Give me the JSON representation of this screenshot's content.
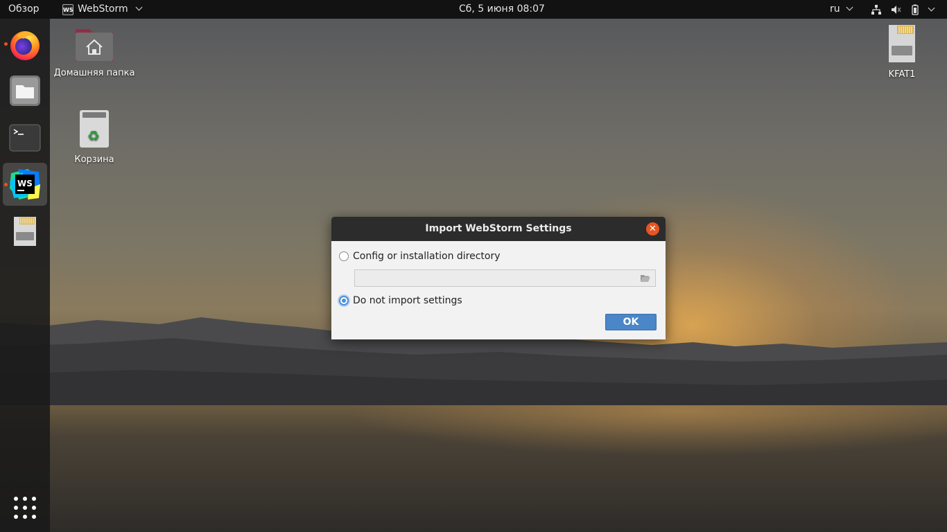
{
  "topbar": {
    "activities": "Обзор",
    "app_name": "WebStorm",
    "app_icon_text": "WS",
    "clock": "Сб, 5 июня  08:07",
    "language": "ru",
    "tray": [
      "network-icon",
      "volume-muted-icon",
      "battery-icon",
      "chevron-down-icon"
    ]
  },
  "dock": {
    "items": [
      {
        "name": "firefox",
        "icon": "firefox-icon",
        "running": true
      },
      {
        "name": "files",
        "icon": "files-icon",
        "running": false
      },
      {
        "name": "terminal",
        "icon": "terminal-icon",
        "running": false
      },
      {
        "name": "webstorm",
        "icon": "webstorm-icon",
        "running": true,
        "active": true,
        "icon_text": "WS"
      },
      {
        "name": "sd-card",
        "icon": "sd-card-icon",
        "running": false
      }
    ],
    "show_apps_icon": "apps-grid-icon"
  },
  "desktop": {
    "home_label": "Домашняя папка",
    "trash_label": "Корзина",
    "drive_label": "KFAT1"
  },
  "dialog": {
    "title": "Import WebStorm Settings",
    "option_config_label": "Config or installation directory",
    "option_config_selected": false,
    "path_value": "",
    "option_none_label": "Do not import settings",
    "option_none_selected": true,
    "ok_label": "OK"
  },
  "colors": {
    "accent": "#e95420",
    "button": "#4a86c8",
    "selected_radio": "#4a90d9",
    "topbar": "#121212"
  }
}
